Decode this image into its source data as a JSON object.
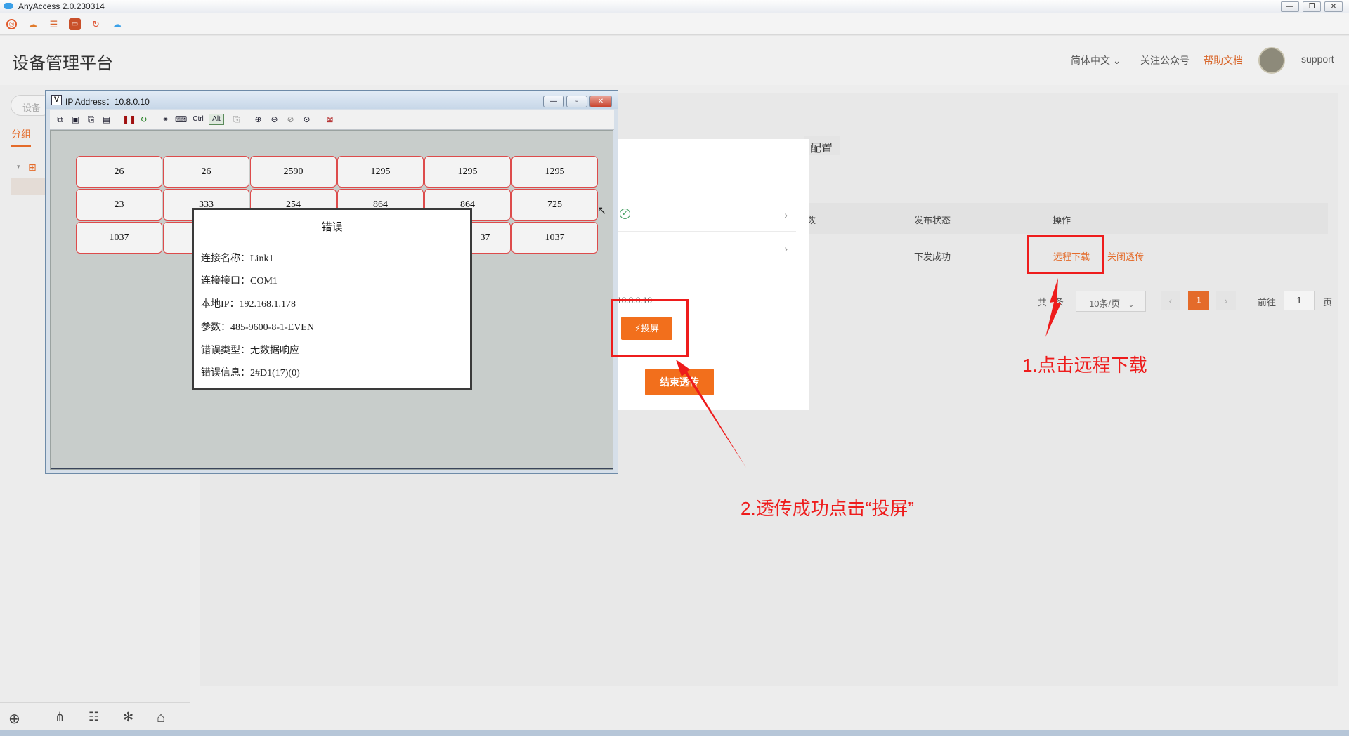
{
  "window": {
    "title": "AnyAccess 2.0.230314",
    "controls": [
      "—",
      "❐",
      "✕"
    ]
  },
  "toolbar": {
    "icons": [
      "settings-icon",
      "cloud-upload-icon",
      "sliders-icon",
      "monitor-icon",
      "refresh-icon",
      "cloud-icon"
    ]
  },
  "app": {
    "title": "设备管理平台",
    "header": {
      "language": "简体中文",
      "follow": "关注公众号",
      "help": "帮助文档",
      "user": "support"
    },
    "sidebar": {
      "search_placeholder": "设备",
      "group_tab": "分组"
    },
    "tab_config": "配置",
    "table": {
      "header_count": "数",
      "header_status": "发布状态",
      "header_action": "操作",
      "row_status": "下发成功",
      "row_download": "远程下载",
      "row_close": "关闭透传"
    },
    "pager": {
      "total_prefix": "共",
      "total_suffix": "条",
      "page_size": "10条/页",
      "current": "1",
      "goto": "前往",
      "goto_value": "1",
      "page": "页"
    }
  },
  "modal": {
    "ip_text": "10.8.0.10",
    "cast_button": "⚡投屏",
    "end_button": "结束透传"
  },
  "vnc": {
    "title": "IP Address：10.8.0.10",
    "toolbar_ctrl": "Ctrl",
    "toolbar_alt": "Alt",
    "rows": [
      [
        "26",
        "26",
        "2590",
        "1295",
        "1295",
        "1295"
      ],
      [
        "23",
        "333",
        "254",
        "864",
        "864",
        "725"
      ],
      [
        "1037",
        "",
        "",
        "",
        "37",
        "1037"
      ]
    ]
  },
  "error": {
    "title": "错误",
    "lines": [
      "连接名称：Link1",
      "连接接口：COM1",
      "本地IP：192.168.1.178",
      "参数：485-9600-8-1-EVEN",
      "错误类型：无数据响应",
      "错误信息：2#D1(17)(0)"
    ]
  },
  "annotations": {
    "step1": "1.点击远程下载",
    "step2": "2.透传成功点击“投屏”"
  },
  "colors": {
    "accent": "#f26f1c",
    "annotation": "#ee1c1c"
  }
}
